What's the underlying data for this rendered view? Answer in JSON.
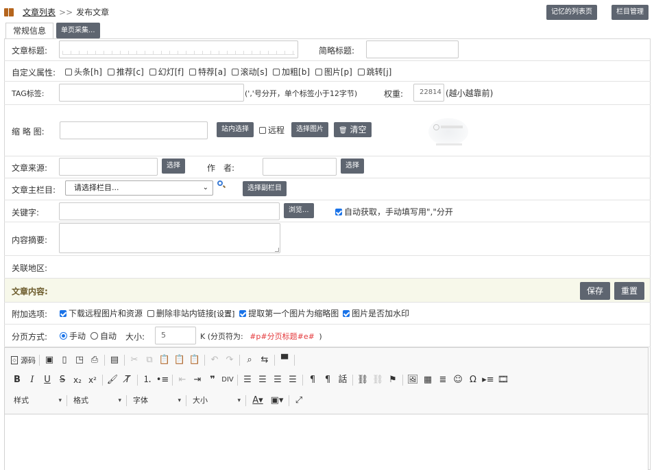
{
  "breadcrumb": {
    "list_link": "文章列表",
    "separator": ">>",
    "current": "发布文章"
  },
  "top_buttons": {
    "remember_list": "记忆的列表页",
    "column_manage": "栏目管理"
  },
  "tabs": {
    "general": "常规信息",
    "single_collect": "单页采集..."
  },
  "title_row": {
    "label": "文章标题:",
    "short_label": "简略标题:"
  },
  "custom_attr": {
    "label": "自定义属性:",
    "items": [
      "头条[h]",
      "推荐[c]",
      "幻灯[f]",
      "特荐[a]",
      "滚动[s]",
      "加粗[b]",
      "图片[p]",
      "跳转[j]"
    ]
  },
  "tag_row": {
    "label": "TAG标签:",
    "hint": "(','号分开，单个标签小于12字节)",
    "weight_label": "权重:",
    "weight_value": "22814",
    "weight_hint": "(越小越靠前)"
  },
  "thumb_row": {
    "label": "缩 略 图:",
    "site_select": "站内选择",
    "remote": "远程",
    "choose_image": "选择图片",
    "clear": "清空",
    "clear_icon": "trash-icon"
  },
  "source_row": {
    "label": "文章来源:",
    "select": "选择",
    "author_label": "作　者:",
    "author_select": "选择"
  },
  "column_row": {
    "label": "文章主栏目:",
    "placeholder": "请选择栏目...",
    "sub_column": "选择副栏目"
  },
  "keyword_row": {
    "label": "关键字:",
    "browse": "浏览...",
    "auto_fetch": "自动获取，手动填写用\",\"分开"
  },
  "summary_row": {
    "label": "内容摘要:"
  },
  "region_row": {
    "label": "关联地区:"
  },
  "content_row": {
    "label": "文章内容:",
    "save": "保存",
    "reset": "重置"
  },
  "extra_row": {
    "label": "附加选项:",
    "download_remote": "下载远程图片和资源",
    "remove_links": "删除非站内链接",
    "set": "[设置]",
    "first_image": "提取第一个图片为缩略图",
    "watermark": "图片是否加水印"
  },
  "paging_row": {
    "label": "分页方式:",
    "manual": "手动",
    "auto": "自动",
    "size_label": "大小:",
    "size_value": "5",
    "unit_hint": "K (分页符为:",
    "page_marker": "#p#分页标题#e#",
    "close": ")"
  },
  "editor": {
    "source": "源码",
    "combos": {
      "style": "样式",
      "format": "格式",
      "font": "字体",
      "size": "大小"
    }
  },
  "colors": {
    "button": "#5e6570",
    "content_bg": "#f7f8ea",
    "marker_red": "#e4393c",
    "accent": "#1a73e8"
  }
}
